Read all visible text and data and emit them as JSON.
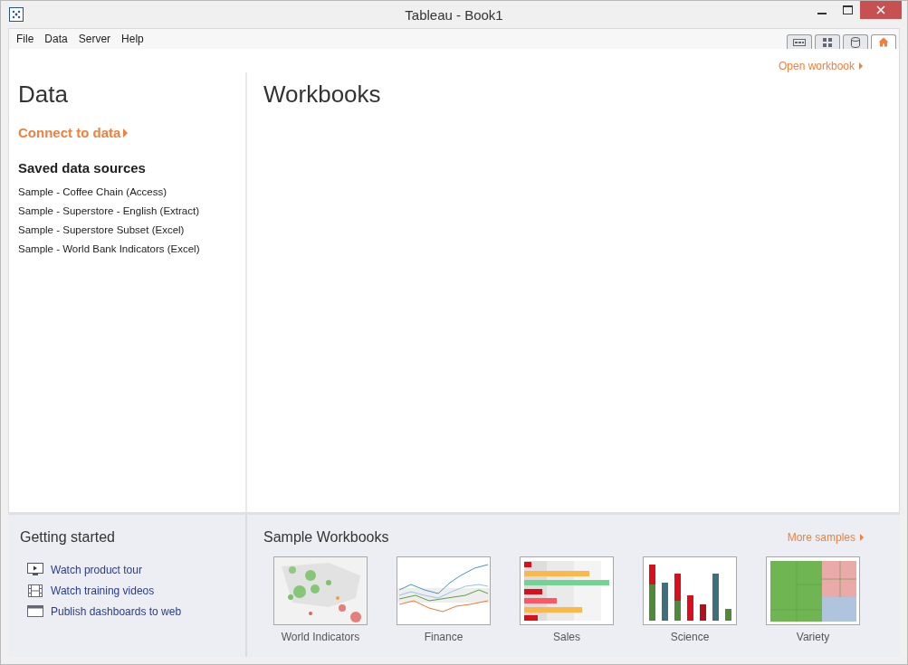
{
  "window": {
    "title": "Tableau - Book1"
  },
  "menu": [
    "File",
    "Data",
    "Server",
    "Help"
  ],
  "view_tabs": [
    {
      "selected": false
    },
    {
      "selected": false
    },
    {
      "selected": false
    },
    {
      "selected": true
    }
  ],
  "open_workbook": "Open workbook",
  "data_panel": {
    "title": "Data",
    "connect": "Connect to data",
    "saved_heading": "Saved data sources",
    "sources": [
      "Sample - Coffee Chain (Access)",
      "Sample - Superstore - English (Extract)",
      "Sample - Superstore Subset (Excel)",
      "Sample - World Bank Indicators (Excel)"
    ]
  },
  "workbooks": {
    "title": "Workbooks"
  },
  "getting_started": {
    "title": "Getting started",
    "links": [
      {
        "label": "Watch product tour"
      },
      {
        "label": "Watch training videos"
      },
      {
        "label": "Publish dashboards to web"
      }
    ]
  },
  "sample_workbooks": {
    "title": "Sample Workbooks",
    "more": "More samples",
    "items": [
      {
        "label": "World Indicators",
        "kind": "picture"
      },
      {
        "label": "Finance",
        "kind": "picture"
      },
      {
        "label": "Sales",
        "kind": "picture"
      },
      {
        "label": "Science",
        "kind": "picture"
      },
      {
        "label": "Variety",
        "kind": "picture"
      }
    ]
  }
}
